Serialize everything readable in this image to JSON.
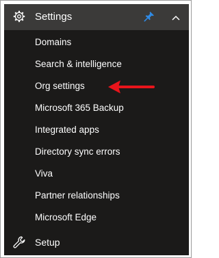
{
  "settings": {
    "label": "Settings",
    "icons": [
      "gear-icon",
      "pin-icon",
      "chevron-up-icon"
    ],
    "items": [
      {
        "label": "Domains"
      },
      {
        "label": "Search & intelligence"
      },
      {
        "label": "Org settings"
      },
      {
        "label": "Microsoft 365 Backup"
      },
      {
        "label": "Integrated apps"
      },
      {
        "label": "Directory sync errors"
      },
      {
        "label": "Viva"
      },
      {
        "label": "Partner relationships"
      },
      {
        "label": "Microsoft Edge"
      }
    ]
  },
  "setup": {
    "label": "Setup",
    "icon": "wrench-icon"
  },
  "annotation": {
    "icon": "red-arrow-icon",
    "color": "#e8141b"
  },
  "colors": {
    "panel_bg": "#1b1a19",
    "header_bg": "#3b3a39",
    "pin": "#2f8ae5"
  }
}
